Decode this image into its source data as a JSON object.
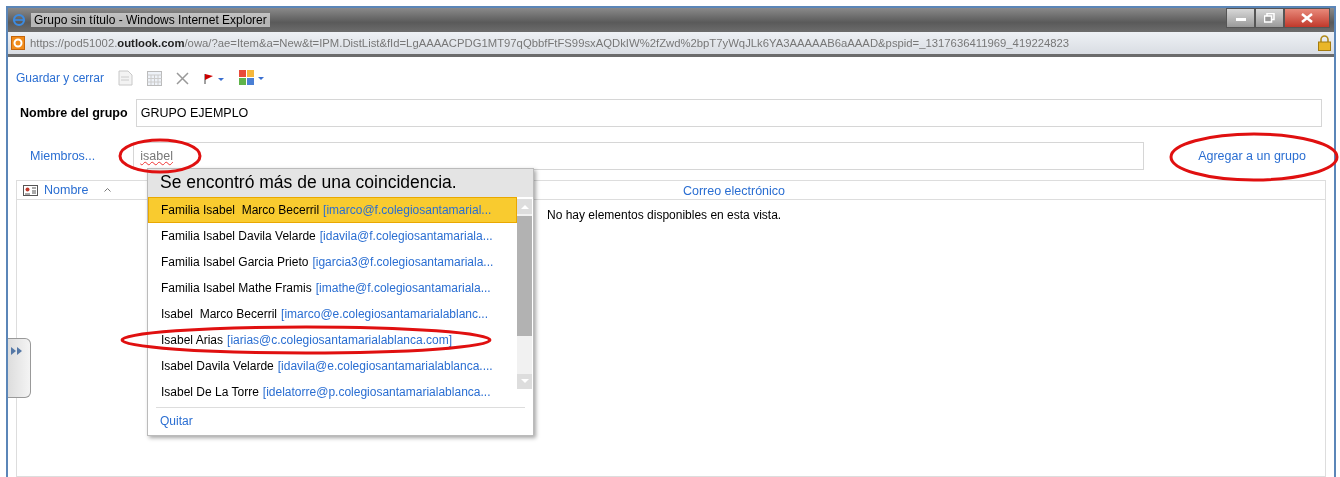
{
  "window": {
    "title": "Grupo sin título - Windows Internet Explorer"
  },
  "address_bar": {
    "url": "https://pod51002.**outlook.com**/owa/?ae=Item&a=New&t=IPM.DistList&fId=LgAAAACPDG1MT97qQbbfFtFS99sxAQDkIW%2fZwd%2bpT7yWqJLk6YA3AAAAAB6aAAAD&pspid=_1317636411969_419224823"
  },
  "toolbar": {
    "save_label": "Guardar y cerrar"
  },
  "group_name": {
    "label": "Nombre del grupo",
    "value": "GRUPO EJEMPLO"
  },
  "members": {
    "label": "Miembros...",
    "value": "isabel",
    "add_link": "Agregar a un grupo"
  },
  "table": {
    "columns": [
      {
        "label": "Nombre",
        "sorted": true
      },
      {
        "label": "Correo electrónico",
        "sorted": false
      }
    ],
    "empty_message": "No hay elementos disponibles en esta vista."
  },
  "suggestions": {
    "header": "Se encontró más de una coincidencia.",
    "items": [
      {
        "name": "Familia Isabel  Marco Becerril",
        "email": "[imarco@f.colegiosantamarial...",
        "selected": true
      },
      {
        "name": "Familia Isabel Davila Velarde",
        "email": "[idavila@f.colegiosantamariala...",
        "selected": false
      },
      {
        "name": "Familia Isabel Garcia Prieto",
        "email": "[igarcia3@f.colegiosantamariala...",
        "selected": false
      },
      {
        "name": "Familia Isabel Mathe Framis",
        "email": "[imathe@f.colegiosantamariala...",
        "selected": false
      },
      {
        "name": "Isabel  Marco Becerril",
        "email": "[imarco@e.colegiosantamarialablanc...",
        "selected": false
      },
      {
        "name": "Isabel Arias",
        "email": "[iarias@c.colegiosantamarialablanca.com]",
        "selected": false
      },
      {
        "name": "Isabel Davila Velarde",
        "email": "[idavila@e.colegiosantamarialablanca....",
        "selected": false
      },
      {
        "name": "Isabel De La Torre",
        "email": "[idelatorre@p.colegiosantamarialablanca...",
        "selected": false
      }
    ],
    "remove_label": "Quitar"
  }
}
